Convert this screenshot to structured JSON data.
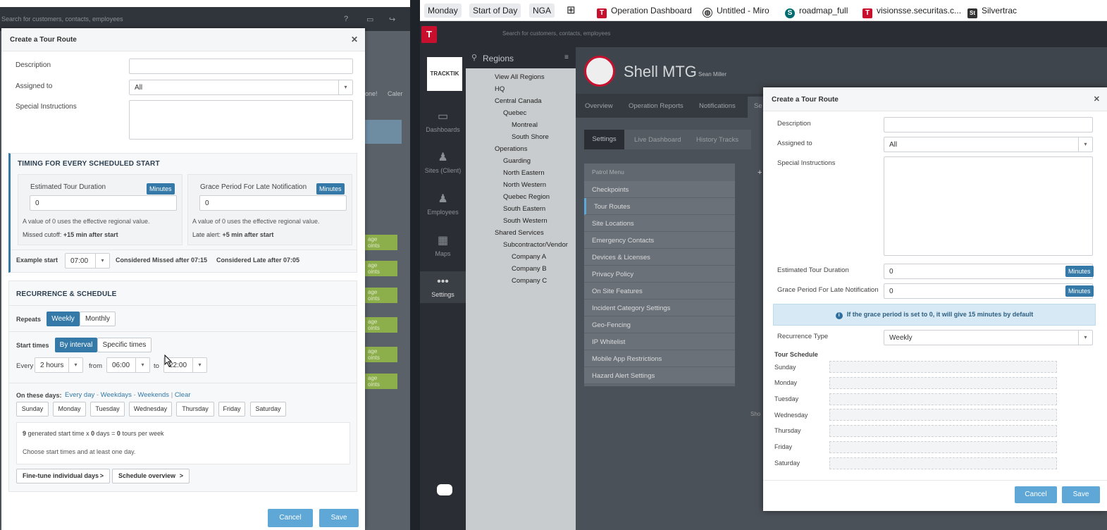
{
  "left_bg": {
    "search_placeholder": "Search for customers, contacts, employees",
    "col_labels": [
      "one!",
      "Caler"
    ],
    "green_btn_text": [
      "age",
      "oints"
    ]
  },
  "left_modal": {
    "title": "Create a Tour Route",
    "description_label": "Description",
    "description_value": "",
    "assigned_label": "Assigned to",
    "assigned_value": "All",
    "special_label": "Special Instructions",
    "special_value": "",
    "timing": {
      "title": "TIMING FOR EVERY SCHEDULED START",
      "duration_label": "Estimated Tour Duration",
      "duration_unit": "Minutes",
      "duration_value": "0",
      "duration_hint": "A value of 0 uses the effective regional value.",
      "missed_label": "Missed cutoff:",
      "missed_value": "+15 min after start",
      "grace_label": "Grace Period For Late Notification",
      "grace_unit": "Minutes",
      "grace_value": "0",
      "grace_hint": "A value of 0 uses the effective regional value.",
      "late_label": "Late alert:",
      "late_value": "+5 min after start",
      "example_label": "Example start",
      "example_value": "07:00",
      "missed_after": "Considered Missed after 07:15",
      "late_after": "Considered Late after 07:05"
    },
    "recurrence": {
      "title": "RECURRENCE & SCHEDULE",
      "repeats_label": "Repeats",
      "repeat_options": [
        "Weekly",
        "Monthly"
      ],
      "start_times_label": "Start times",
      "start_options": [
        "By interval",
        "Specific times"
      ],
      "every_label": "Every",
      "every_value": "2 hours",
      "from_label": "from",
      "from_value": "06:00",
      "to_label": "to",
      "to_value": "22:00",
      "days_label": "On these days:",
      "day_links": [
        "Every day",
        "Weekdays",
        "Weekends",
        "Clear"
      ],
      "days": [
        "Sunday",
        "Monday",
        "Tuesday",
        "Wednesday",
        "Thursday",
        "Friday",
        "Saturday"
      ],
      "summary_starts": "9",
      "summary_mid1": "generated start time x",
      "summary_days": "0",
      "summary_mid2": "days =",
      "summary_tours": "0",
      "summary_end": "tours per week",
      "summary_hint": "Choose start times and at least one day.",
      "finetune_btn": "Fine-tune individual days",
      "overview_btn": "Schedule overview"
    },
    "cancel": "Cancel",
    "save": "Save"
  },
  "bookmarks": [
    {
      "label": "Monday"
    },
    {
      "label": "Start of Day"
    },
    {
      "label": "NGA"
    },
    {
      "label": "Operation Dashboard"
    },
    {
      "label": "Untitled - Miro"
    },
    {
      "label": "roadmap_full"
    },
    {
      "label": "visionsse.securitas.c..."
    },
    {
      "label": "Silvertrac"
    }
  ],
  "right_app": {
    "search_placeholder": "Search for customers, contacts, employees",
    "logo_text": "TRACKTIK",
    "nav": [
      "Dashboards",
      "Sites (Client)",
      "Employees",
      "Maps",
      "Settings"
    ],
    "regions_title": "Regions",
    "tree": [
      "View All Regions",
      "HQ",
      "Central Canada",
      "Quebec",
      "Montreal",
      "South Shore",
      "Operations",
      "Guarding",
      "North Eastern",
      "North Western",
      "Quebec Region",
      "South Eastern",
      "South Western",
      "Shared Services",
      "Subcontractor/Vendor",
      "Company A",
      "Company B",
      "Company C"
    ],
    "site_name": "Shell MTG",
    "site_owner": "Sean Miller",
    "tabs": [
      "Overview",
      "Operation Reports",
      "Notifications",
      "Se"
    ],
    "subtabs": [
      "Settings",
      "Live Dashboard",
      "History Tracks"
    ],
    "patrol_menu_title": "Patrol Menu",
    "patrol_menu": [
      "Checkpoints",
      "Tour Routes",
      "Site Locations",
      "Emergency Contacts",
      "Devices & Licenses",
      "Privacy Policy",
      "On Site Features",
      "Incident Category Settings",
      "Geo-Fencing",
      "IP Whitelist",
      "Mobile App Restrictions",
      "Hazard Alert Settings"
    ],
    "partial_text": "Sho"
  },
  "right_modal": {
    "title": "Create a Tour Route",
    "description_label": "Description",
    "description_value": "",
    "assigned_label": "Assigned to",
    "assigned_value": "All",
    "special_label": "Special Instructions",
    "special_value": "",
    "duration_label": "Estimated Tour Duration",
    "duration_value": "0",
    "duration_unit": "Minutes",
    "grace_label": "Grace Period For Late Notification",
    "grace_value": "0",
    "grace_unit": "Minutes",
    "info": "If the grace period is set to 0, it will give 15 minutes by default",
    "recurrence_label": "Recurrence Type",
    "recurrence_value": "Weekly",
    "schedule_title": "Tour Schedule",
    "days": [
      "Sunday",
      "Monday",
      "Tuesday",
      "Wednesday",
      "Thursday",
      "Friday",
      "Saturday"
    ],
    "cancel": "Cancel",
    "save": "Save"
  }
}
